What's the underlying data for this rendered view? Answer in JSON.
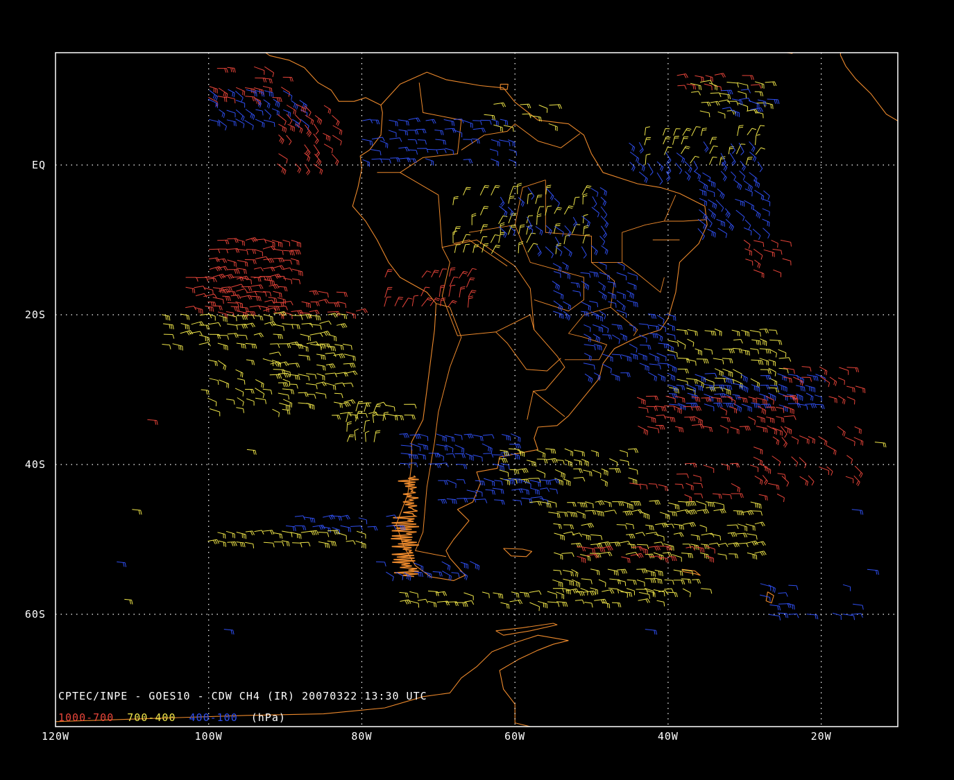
{
  "title": "CPTEC/INPE - GOES10 - CDW CH4 (IR) 20070322 13:30 UTC",
  "legend": [
    {
      "text": "1000-700",
      "color": "#e8453a"
    },
    {
      "text": "700-400",
      "color": "#f0e64a"
    },
    {
      "text": "400-100",
      "color": "#2f4ff0"
    },
    {
      "text": "(hPa)",
      "color": "#ffffff"
    }
  ],
  "colors": {
    "background": "#000000",
    "frame": "#ffffff",
    "grid": "#ffffff",
    "coastline": "#ee8a2c",
    "low": "#e8453a",
    "mid": "#f0e64a",
    "high": "#2f4ff0"
  },
  "map": {
    "lon_range": [
      -120,
      -10
    ],
    "lat_range": [
      -75,
      15
    ],
    "lon_ticks": [
      {
        "value": -120,
        "label": "120W"
      },
      {
        "value": -100,
        "label": "100W"
      },
      {
        "value": -80,
        "label": "80W"
      },
      {
        "value": -60,
        "label": "60W"
      },
      {
        "value": -40,
        "label": "40W"
      },
      {
        "value": -20,
        "label": "20W"
      }
    ],
    "lat_ticks": [
      {
        "value": 0,
        "label": "EQ"
      },
      {
        "value": -20,
        "label": "20S"
      },
      {
        "value": -40,
        "label": "40S"
      },
      {
        "value": -60,
        "label": "60S"
      }
    ]
  }
}
